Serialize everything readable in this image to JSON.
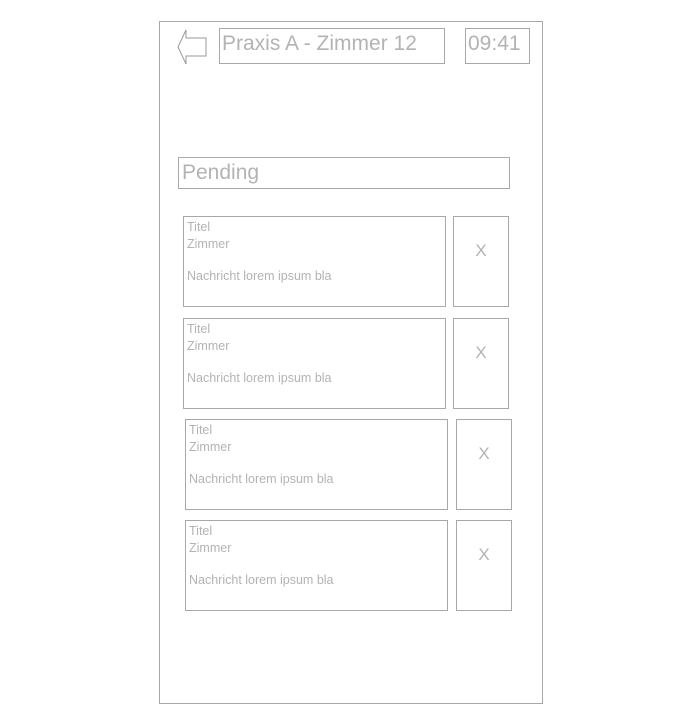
{
  "header": {
    "title": "Praxis A - Zimmer 12",
    "time": "09:41"
  },
  "section": {
    "title": "Pending"
  },
  "notifications": [
    {
      "title": "Titel",
      "room": "Zimmer",
      "message": "Nachricht lorem ipsum bla",
      "dismiss_label": "X"
    },
    {
      "title": "Titel",
      "room": "Zimmer",
      "message": "Nachricht lorem ipsum bla",
      "dismiss_label": "X"
    },
    {
      "title": "Titel",
      "room": "Zimmer",
      "message": "Nachricht lorem ipsum bla",
      "dismiss_label": "X"
    },
    {
      "title": "Titel",
      "room": "Zimmer",
      "message": "Nachricht lorem ipsum bla",
      "dismiss_label": "X"
    }
  ],
  "icons": {
    "back": "back-arrow-icon"
  },
  "colors": {
    "border": "#a8a8a8",
    "text": "#b3b3b3",
    "background": "#ffffff"
  }
}
